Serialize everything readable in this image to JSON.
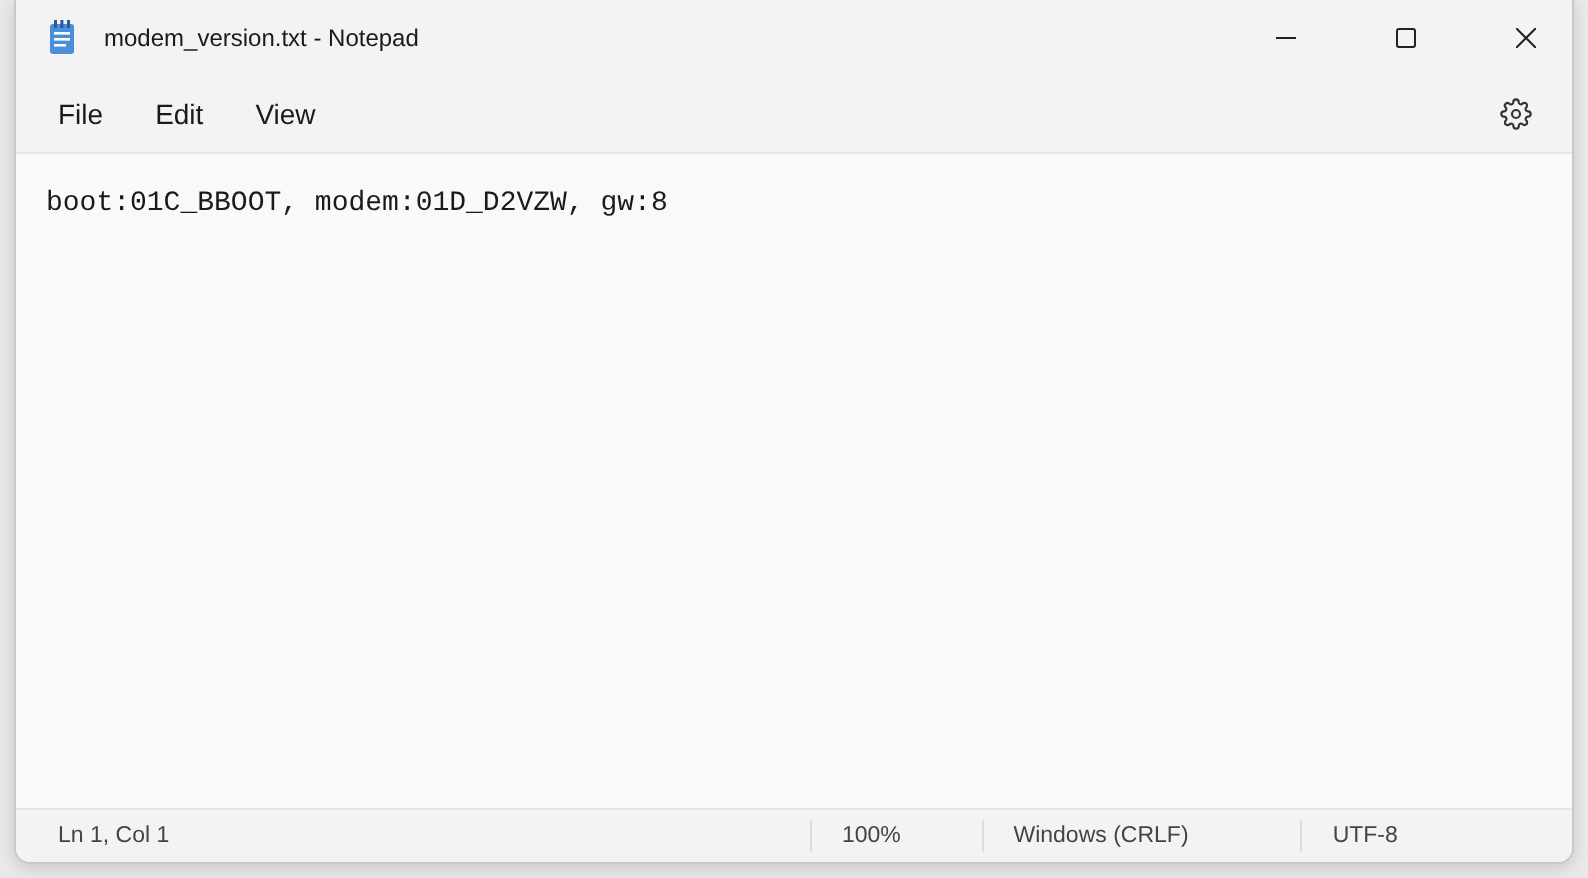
{
  "window": {
    "title": "modem_version.txt - Notepad"
  },
  "menu": [
    "File",
    "Edit",
    "View"
  ],
  "document": {
    "text": "boot:01C_BBOOT, modem:01D_D2VZW, gw:8"
  },
  "status_bar": [
    "Ln 1, Col 1",
    "100%",
    "Windows (CRLF)",
    "UTF-8"
  ]
}
